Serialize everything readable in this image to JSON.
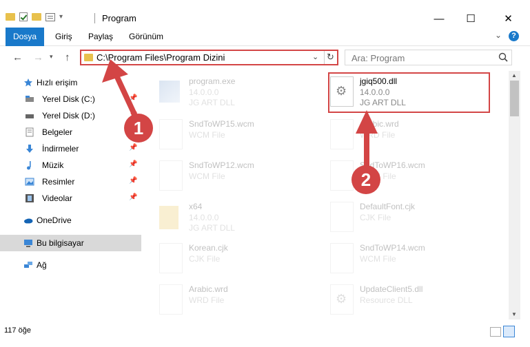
{
  "window": {
    "title": "Program"
  },
  "ribbon": {
    "tabs": [
      "Dosya",
      "Giriş",
      "Paylaş",
      "Görünüm"
    ]
  },
  "address": {
    "path": "C:\\Program Files\\Program Dizini"
  },
  "search": {
    "placeholder": "Ara: Program"
  },
  "nav": {
    "quick_access": "Hızlı erişim",
    "items": [
      "Yerel Disk (C:)",
      "Yerel Disk (D:)",
      "Belgeler",
      "İndirmeler",
      "Müzik",
      "Resimler",
      "Videolar"
    ],
    "onedrive": "OneDrive",
    "this_pc": "Bu bilgisayar",
    "network": "Ağ"
  },
  "files": [
    {
      "name": "program.exe",
      "line2": "14.0.0.0",
      "line3": "JG ART DLL"
    },
    {
      "name": "jgiq500.dll",
      "line2": "14.0.0.0",
      "line3": "JG ART DLL"
    },
    {
      "name": "SndToWP15.wcm",
      "line2": "WCM File"
    },
    {
      "name": "Arabic.wrd",
      "line2": "WRD File"
    },
    {
      "name": "SndToWP12.wcm",
      "line2": "WCM File"
    },
    {
      "name": "SndToWP16.wcm",
      "line2": "WCM File"
    },
    {
      "name": "x64",
      "line2": "14.0.0.0",
      "line3": "JG ART DLL"
    },
    {
      "name": "DefaultFont.cjk",
      "line2": "CJK File"
    },
    {
      "name": "Korean.cjk",
      "line2": "CJK File"
    },
    {
      "name": "SndToWP14.wcm",
      "line2": "WCM File"
    },
    {
      "name": "Arabic.wrd",
      "line2": "WRD File"
    },
    {
      "name": "UpdateClient5.dll",
      "line2": "Resource DLL"
    }
  ],
  "badges": [
    "1",
    "2"
  ],
  "status": {
    "count": "117 öğe"
  },
  "colors": {
    "accent": "#1979ca",
    "annotation": "#d34545",
    "folder": "#e8c14d"
  }
}
